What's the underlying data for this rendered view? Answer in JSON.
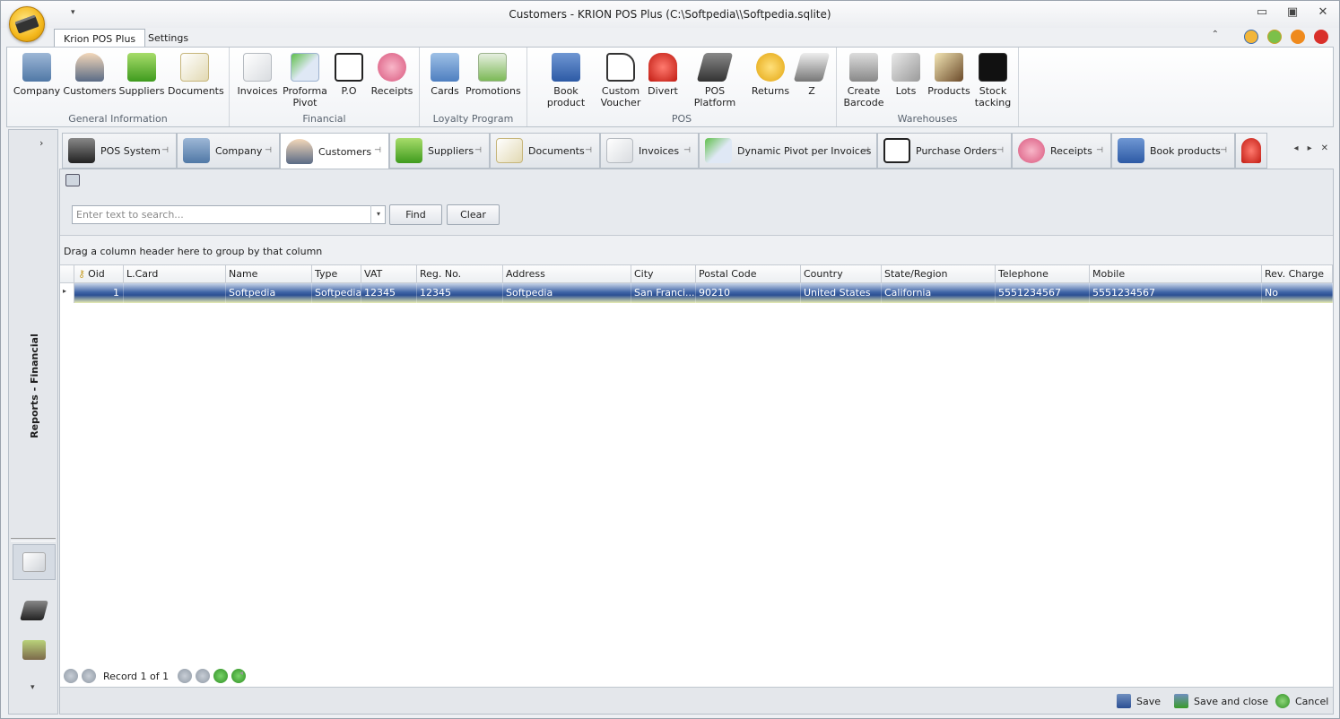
{
  "window": {
    "title": "Customers - KRION POS Plus (C:\\Softpedia\\\\Softpedia.sqlite)",
    "qat_glyph": "▾"
  },
  "ribbon_tabs": [
    "Krion POS Plus",
    "Settings"
  ],
  "ribbon": {
    "groups": [
      {
        "label": "General Information",
        "buttons": [
          "Company",
          "Customers",
          "Suppliers",
          "Documents"
        ]
      },
      {
        "label": "Financial",
        "buttons": [
          "Invoices",
          "Proforma Pivot",
          "P.O",
          "Receipts"
        ]
      },
      {
        "label": "Loyalty Program",
        "buttons": [
          "Cards",
          "Promotions"
        ]
      },
      {
        "label": "POS",
        "buttons": [
          "Book product",
          "Custom Voucher",
          "Divert",
          "POS Platform",
          "Returns",
          "Z"
        ]
      },
      {
        "label": "Warehouses",
        "buttons": [
          "Create Barcode",
          "Lots",
          "Products",
          "Stock tacking"
        ]
      }
    ]
  },
  "side_panel": {
    "vertical_label": "Reports - Financial",
    "expand_glyph": "›",
    "collapse_glyph": "▾"
  },
  "doc_tabs": [
    "POS System",
    "Company",
    "Customers",
    "Suppliers",
    "Documents",
    "Invoices",
    "Dynamic Pivot per Invoices",
    "Purchase Orders",
    "Receipts",
    "Book products"
  ],
  "active_doc_tab": "Customers",
  "tab_nav": {
    "left": "◂",
    "right": "▸",
    "close": "✕"
  },
  "search": {
    "placeholder": "Enter text to search...",
    "find_label": "Find",
    "clear_label": "Clear"
  },
  "group_hint": "Drag a column header here to group by that column",
  "grid": {
    "columns": [
      "Oid",
      "L.Card",
      "Name",
      "Type",
      "VAT",
      "Reg. No.",
      "Address",
      "City",
      "Postal Code",
      "Country",
      "State/Region",
      "Telephone",
      "Mobile",
      "Rev. Charge"
    ],
    "rows": [
      [
        "1",
        "",
        "Softpedia",
        "Softpedia",
        "12345",
        "12345",
        "Softpedia",
        "San Franci...",
        "90210",
        "United States",
        "California",
        "5551234567",
        "5551234567",
        "No"
      ]
    ]
  },
  "record_nav": {
    "text": "Record 1 of 1"
  },
  "bottom_actions": {
    "save": "Save",
    "save_close": "Save and close",
    "cancel": "Cancel"
  },
  "colors": {
    "accent": "#2c4f93",
    "orb": "#f4b81c"
  }
}
